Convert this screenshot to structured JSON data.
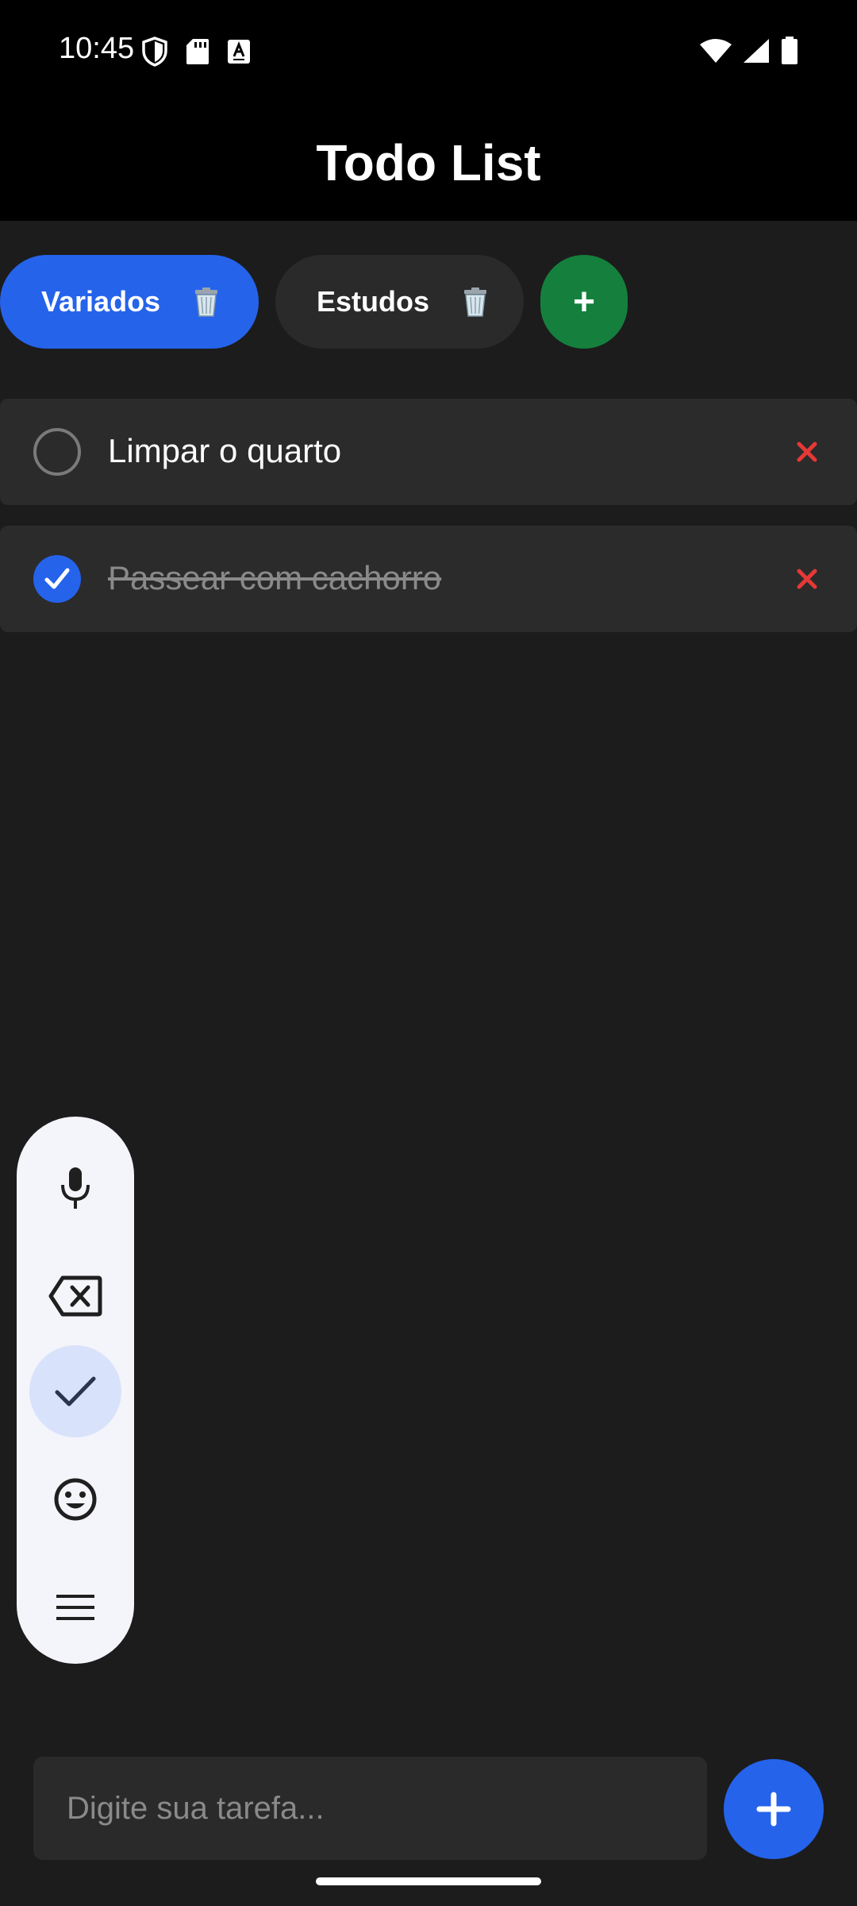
{
  "status_bar": {
    "time": "10:45",
    "icons_left": [
      "shield-icon",
      "sd-card-icon",
      "keyboard-a-icon"
    ],
    "icons_right": [
      "wifi-icon",
      "signal-icon",
      "battery-icon"
    ]
  },
  "header": {
    "title": "Todo List"
  },
  "tabs": [
    {
      "label": "Variados",
      "active": true,
      "icon": "trash-icon"
    },
    {
      "label": "Estudos",
      "active": false,
      "icon": "trash-icon"
    }
  ],
  "add_tab_label": "+",
  "tasks": [
    {
      "label": "Limpar o quarto",
      "done": false
    },
    {
      "label": "Passear com cachorro",
      "done": true
    }
  ],
  "floating_toolbar": {
    "buttons": [
      "microphone-icon",
      "backspace-icon",
      "check-icon",
      "emoji-icon",
      "menu-icon"
    ],
    "active": "check-icon"
  },
  "input": {
    "placeholder": "Digite sua tarefa...",
    "value": ""
  },
  "colors": {
    "accent": "#2563eb",
    "add_tab": "#15803d",
    "delete": "#e53935",
    "background": "#1c1c1c",
    "header": "#000000"
  }
}
